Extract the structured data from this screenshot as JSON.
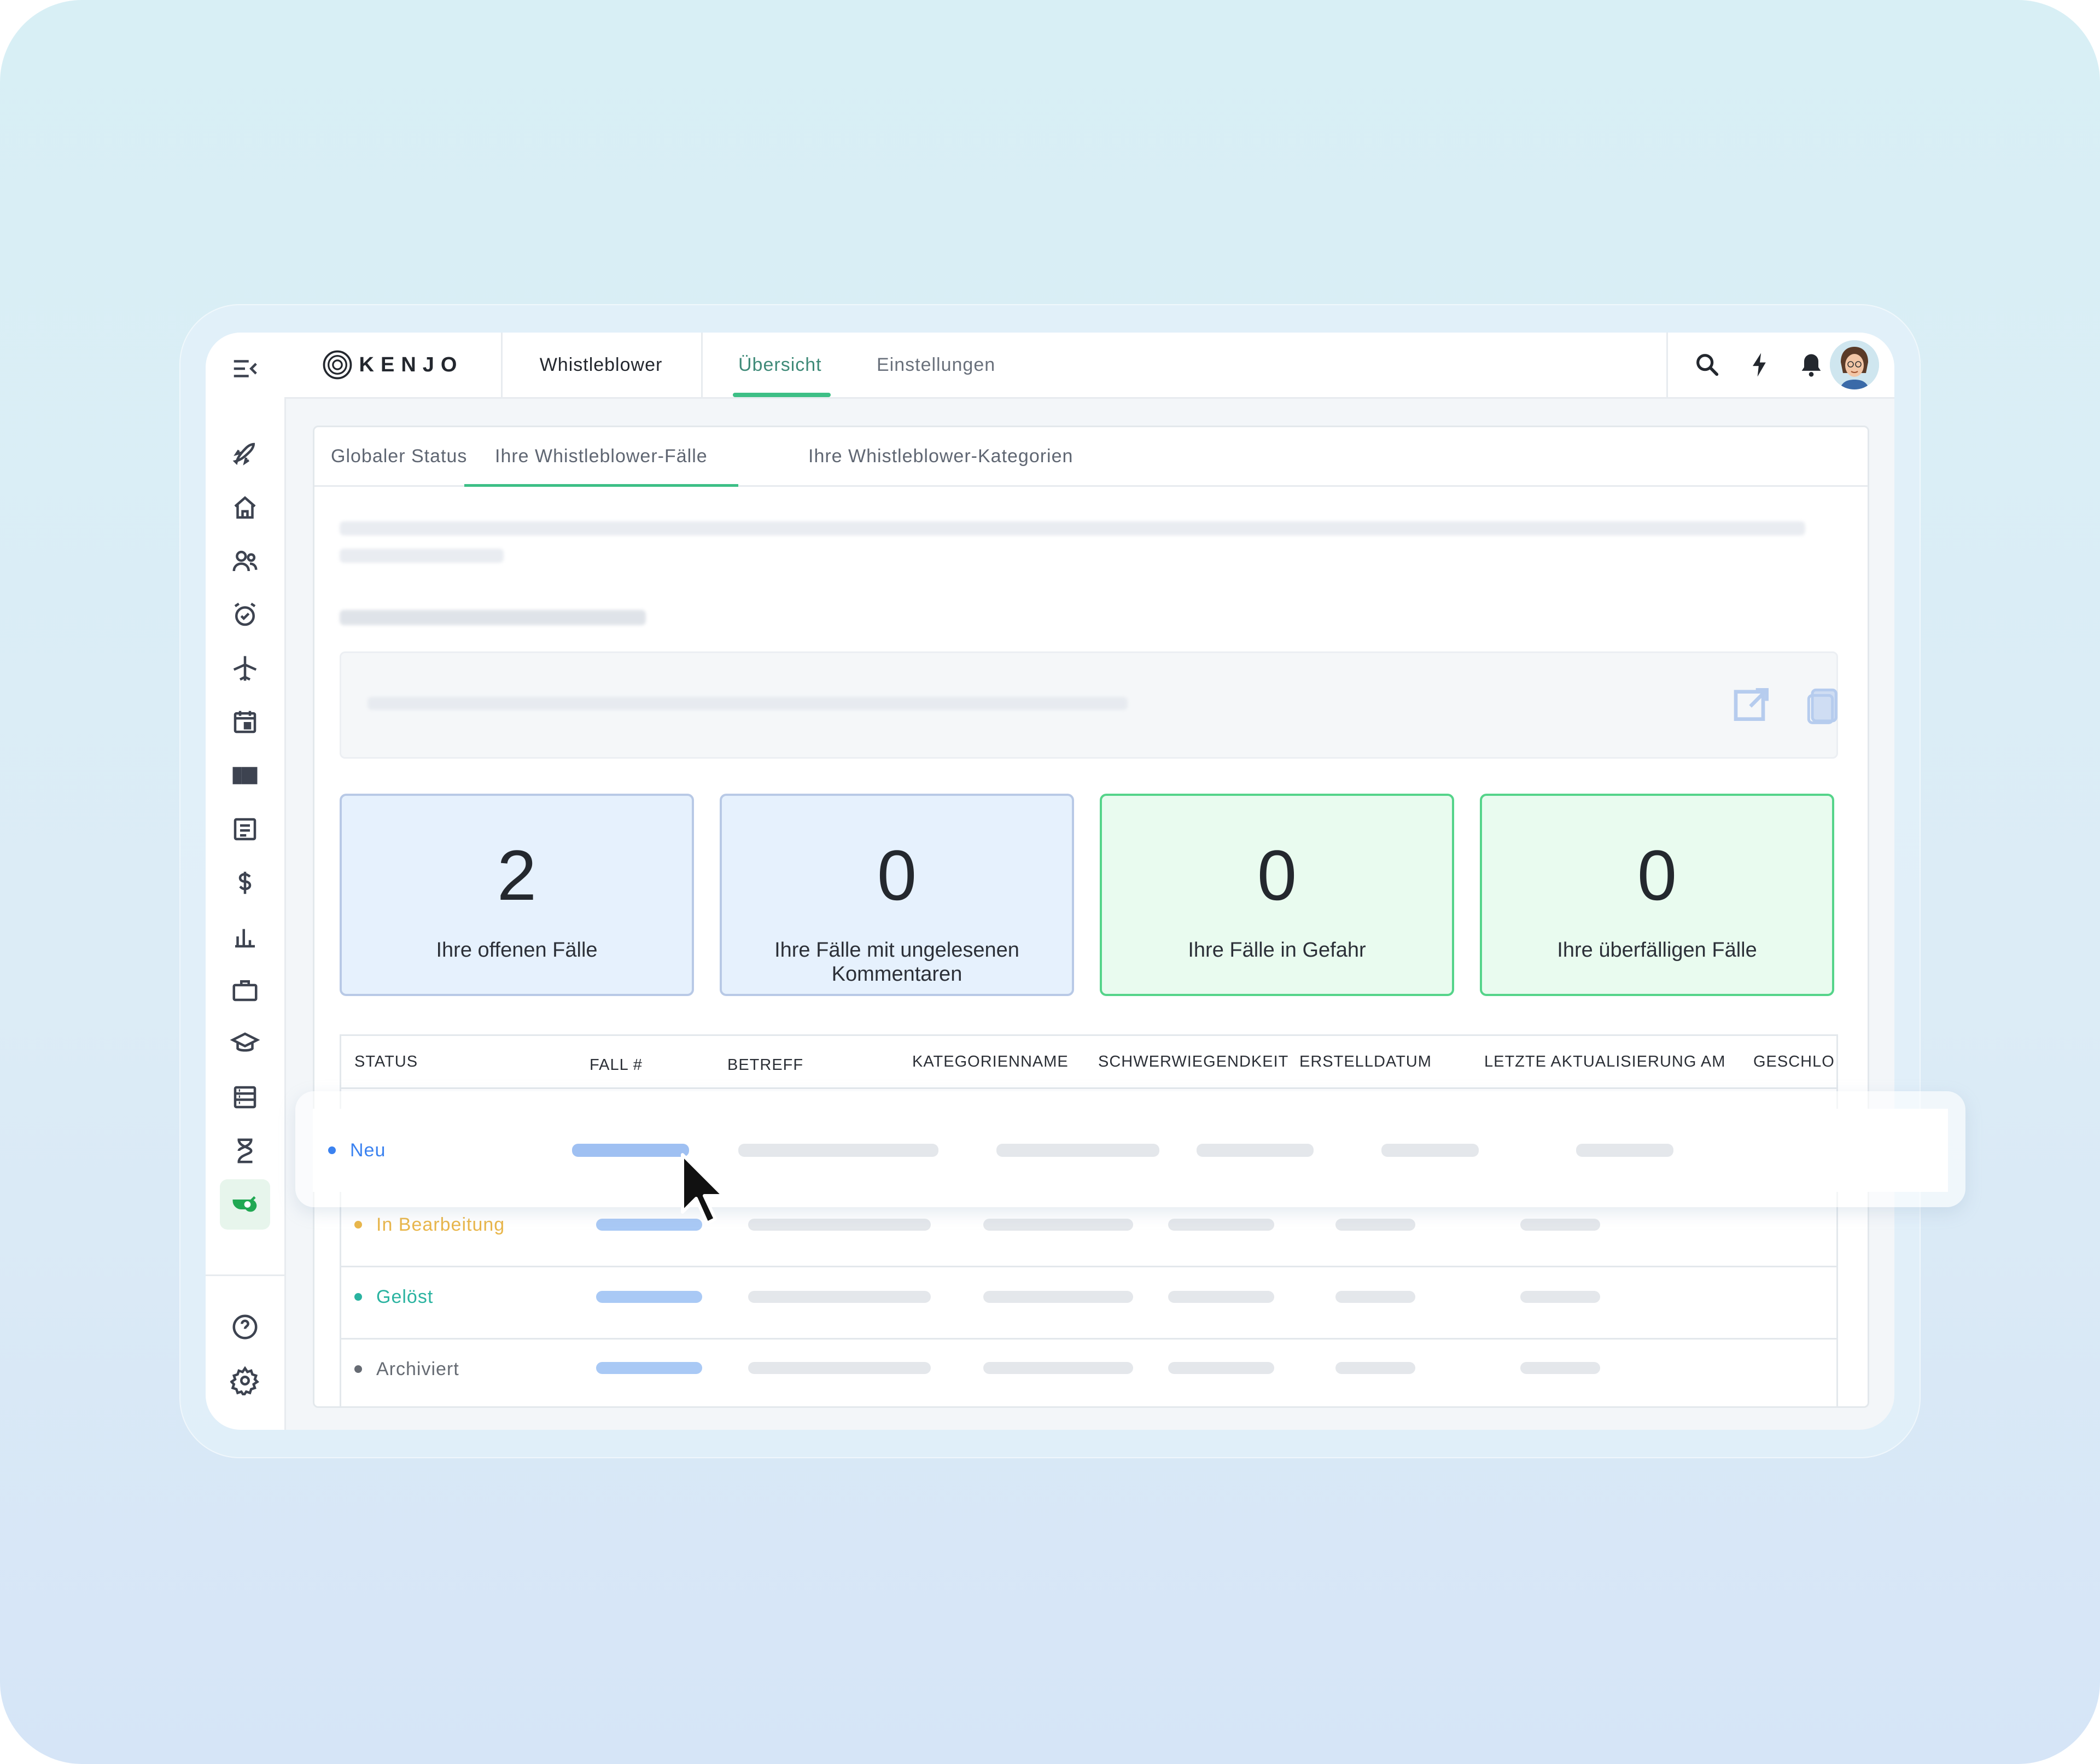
{
  "brand": {
    "name": "KENJO"
  },
  "app": {
    "name": "Whistleblower"
  },
  "top_tabs": [
    {
      "label": "Übersicht",
      "active": true
    },
    {
      "label": "Einstellungen",
      "active": false
    }
  ],
  "top_icons": [
    "search-icon",
    "bolt-icon",
    "bell-icon",
    "user-avatar"
  ],
  "rail_icons": [
    "rocket-icon",
    "home-icon",
    "people-icon",
    "alarm-clock-icon",
    "airplane-icon",
    "calendar-icon",
    "columns-icon",
    "document-icon",
    "dollar-icon",
    "bar-chart-icon",
    "briefcase-icon",
    "graduation-cap-icon",
    "database-icon",
    "hourglass-icon",
    "whistle-icon",
    "help-icon",
    "settings-icon"
  ],
  "sub_tabs": [
    {
      "label": "Globaler Status",
      "active": false
    },
    {
      "label": "Ihre Whistleblower-Fälle",
      "active": true
    },
    {
      "label": "Ihre Whistleblower-Kategorien",
      "active": false
    }
  ],
  "url_actions": [
    "open-external-icon",
    "copy-icon"
  ],
  "stats": [
    {
      "value": "2",
      "label": "Ihre offenen Fälle",
      "tone": "blue"
    },
    {
      "value": "0",
      "label": "Ihre Fälle mit ungelesenen Kommentaren",
      "tone": "blue"
    },
    {
      "value": "0",
      "label": "Ihre Fälle in Gefahr",
      "tone": "green"
    },
    {
      "value": "0",
      "label": "Ihre überfälligen Fälle",
      "tone": "green"
    }
  ],
  "table": {
    "columns": [
      "STATUS",
      "FALL #",
      "BETREFF",
      "KATEGORIENNAME",
      "SCHWERWIEGENDKEIT",
      "ERSTELLDATUM",
      "LETZTE AKTUALISIERUNG AM",
      "GESCHLO"
    ],
    "rows": [
      {
        "status": "Neu",
        "color": "#3b82f0"
      },
      {
        "status": "In Bearbeitung",
        "color": "#e9b64a"
      },
      {
        "status": "Gelöst",
        "color": "#2ab3a0"
      },
      {
        "status": "Archiviert",
        "color": "#666b73"
      }
    ]
  },
  "colors": {
    "accent": "#3dbf86",
    "active_rail": "#21a853",
    "stat_blue_bg": "#e6f1fd",
    "stat_green_bg": "#e9fbef"
  }
}
